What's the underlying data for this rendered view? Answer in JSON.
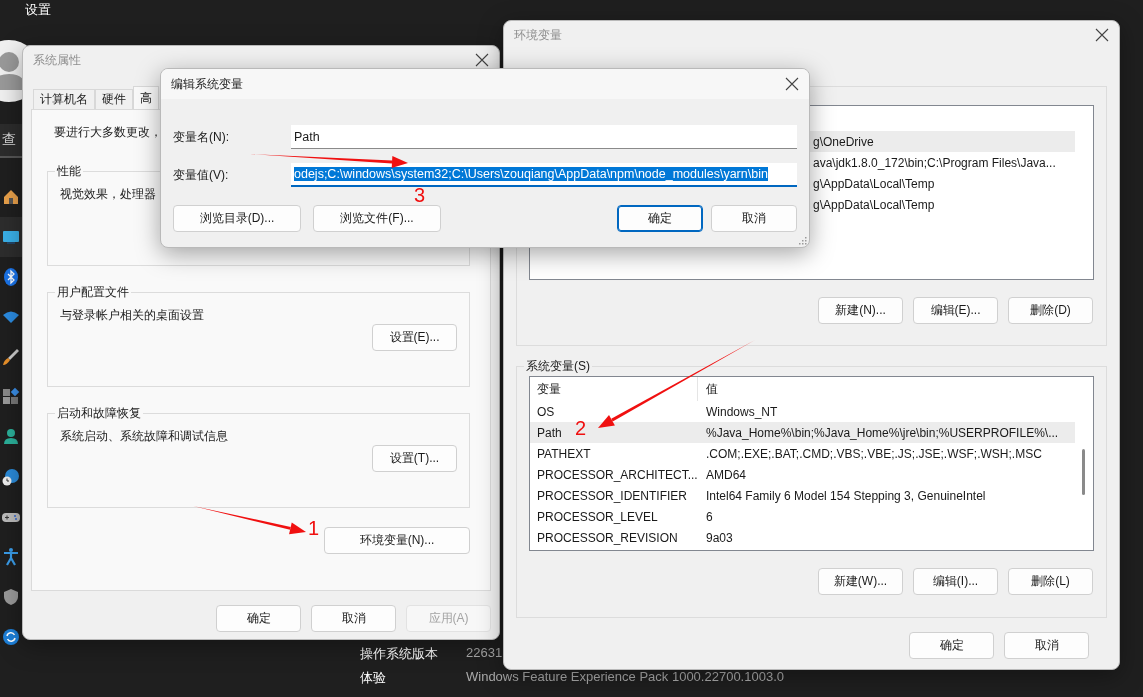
{
  "settings": {
    "title": "设置",
    "search_text": "查",
    "nav": [
      {
        "selected": false
      },
      {
        "selected": true
      },
      {
        "selected": false
      },
      {
        "selected": false
      },
      {
        "selected": false
      },
      {
        "selected": false
      },
      {
        "selected": false
      },
      {
        "selected": false
      },
      {
        "selected": false
      },
      {
        "selected": false
      },
      {
        "selected": false
      },
      {
        "selected": false
      }
    ],
    "info": [
      {
        "label": "操作系统版本",
        "value": "22631"
      },
      {
        "label": "体验",
        "value": "Windows Feature Experience Pack 1000.22700.1003.0"
      }
    ]
  },
  "system_properties": {
    "title": "系统属性",
    "tabs": [
      {
        "label": "计算机名",
        "selected": false
      },
      {
        "label": "硬件",
        "selected": false
      },
      {
        "label": "高",
        "selected": true
      }
    ],
    "intro": "要进行大多数更改，",
    "groups": [
      {
        "title": "性能",
        "text": "视觉效果，处理器"
      },
      {
        "title": "用户配置文件",
        "text": "与登录帐户相关的桌面设置",
        "button": "设置(E)..."
      },
      {
        "title": "启动和故障恢复",
        "text": "系统启动、系统故障和调试信息",
        "button": "设置(T)..."
      }
    ],
    "env_button": "环境变量(N)...",
    "buttons": [
      {
        "label": "确定",
        "disabled": false
      },
      {
        "label": "取消",
        "disabled": false
      },
      {
        "label": "应用(A)",
        "disabled": true
      }
    ]
  },
  "environment_variables": {
    "title": "环境变量",
    "user_rows": [
      {
        "value": "g\\OneDrive",
        "selected": true
      },
      {
        "value": "ava\\jdk1.8.0_172\\bin;C:\\Program Files\\Java...",
        "selected": false
      },
      {
        "value": "g\\AppData\\Local\\Temp",
        "selected": false
      },
      {
        "value": "g\\AppData\\Local\\Temp",
        "selected": false
      }
    ],
    "user_buttons": [
      "新建(N)...",
      "编辑(E)...",
      "删除(D)"
    ],
    "system_title": "系统变量(S)",
    "columns": [
      "变量",
      "值"
    ],
    "system_rows": [
      {
        "name": "OS",
        "value": "Windows_NT",
        "selected": false
      },
      {
        "name": "Path",
        "value": "%Java_Home%\\bin;%Java_Home%\\jre\\bin;%USERPROFILE%\\...",
        "selected": true
      },
      {
        "name": "PATHEXT",
        "value": ".COM;.EXE;.BAT;.CMD;.VBS;.VBE;.JS;.JSE;.WSF;.WSH;.MSC",
        "selected": false
      },
      {
        "name": "PROCESSOR_ARCHITECT...",
        "value": "AMD64",
        "selected": false
      },
      {
        "name": "PROCESSOR_IDENTIFIER",
        "value": "Intel64 Family 6 Model 154 Stepping 3, GenuineIntel",
        "selected": false
      },
      {
        "name": "PROCESSOR_LEVEL",
        "value": "6",
        "selected": false
      },
      {
        "name": "PROCESSOR_REVISION",
        "value": "9a03",
        "selected": false
      }
    ],
    "system_buttons": [
      "新建(W)...",
      "编辑(I)...",
      "删除(L)"
    ],
    "buttons": [
      "确定",
      "取消"
    ]
  },
  "edit_dialog": {
    "title": "编辑系统变量",
    "name_label": "变量名(N):",
    "name_value": "Path",
    "value_label": "变量值(V):",
    "value_value": "odejs;C:\\windows\\system32;C:\\Users\\zouqiang\\AppData\\npm\\node_modules\\yarn\\bin",
    "value_selected": true,
    "buttons": [
      {
        "label": "浏览目录(D)...",
        "default": false
      },
      {
        "label": "浏览文件(F)...",
        "default": false
      },
      {
        "label": "确定",
        "default": true
      },
      {
        "label": "取消",
        "default": false
      }
    ]
  },
  "annotations": [
    {
      "label": "1"
    },
    {
      "label": "2"
    },
    {
      "label": "3"
    }
  ]
}
